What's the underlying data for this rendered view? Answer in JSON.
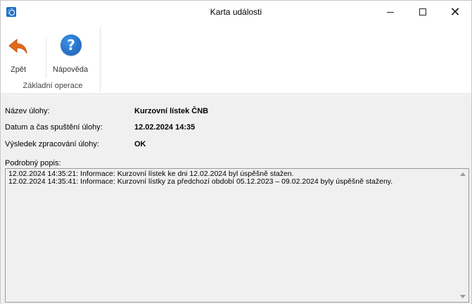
{
  "window": {
    "title": "Karta události",
    "accent_color": "#1f6fc9"
  },
  "titlebar": {
    "minimize_icon": "minimize-icon",
    "maximize_icon": "maximize-icon",
    "close_icon": "close-icon",
    "close_glyph": "✕"
  },
  "ribbon": {
    "group_label": "Základní operace",
    "back_label": "Zpět",
    "help_label": "Nápověda",
    "help_glyph": "?",
    "back_icon": "back-arrow-icon",
    "help_icon": "help-icon",
    "back_color": "#e26a1b",
    "help_color": "#1f6fc9"
  },
  "details": {
    "task_name_label": "Název úlohy:",
    "task_name_value": "Kurzovní lístek ČNB",
    "start_label": "Datum a čas spuštění úlohy:",
    "start_value": "12.02.2024  14:35",
    "result_label": "Výsledek zpracování úlohy:",
    "result_value": "OK"
  },
  "description": {
    "label": "Podrobný popis:",
    "lines": [
      "12.02.2024 14:35:21: Informace: Kurzovní lístek ke dni 12.02.2024 byl úspěšně stažen.",
      "12.02.2024 14:35:41: Informace: Kurzovní lístky za předchozí období 05.12.2023 – 09.02.2024 byly úspěšně staženy."
    ]
  }
}
